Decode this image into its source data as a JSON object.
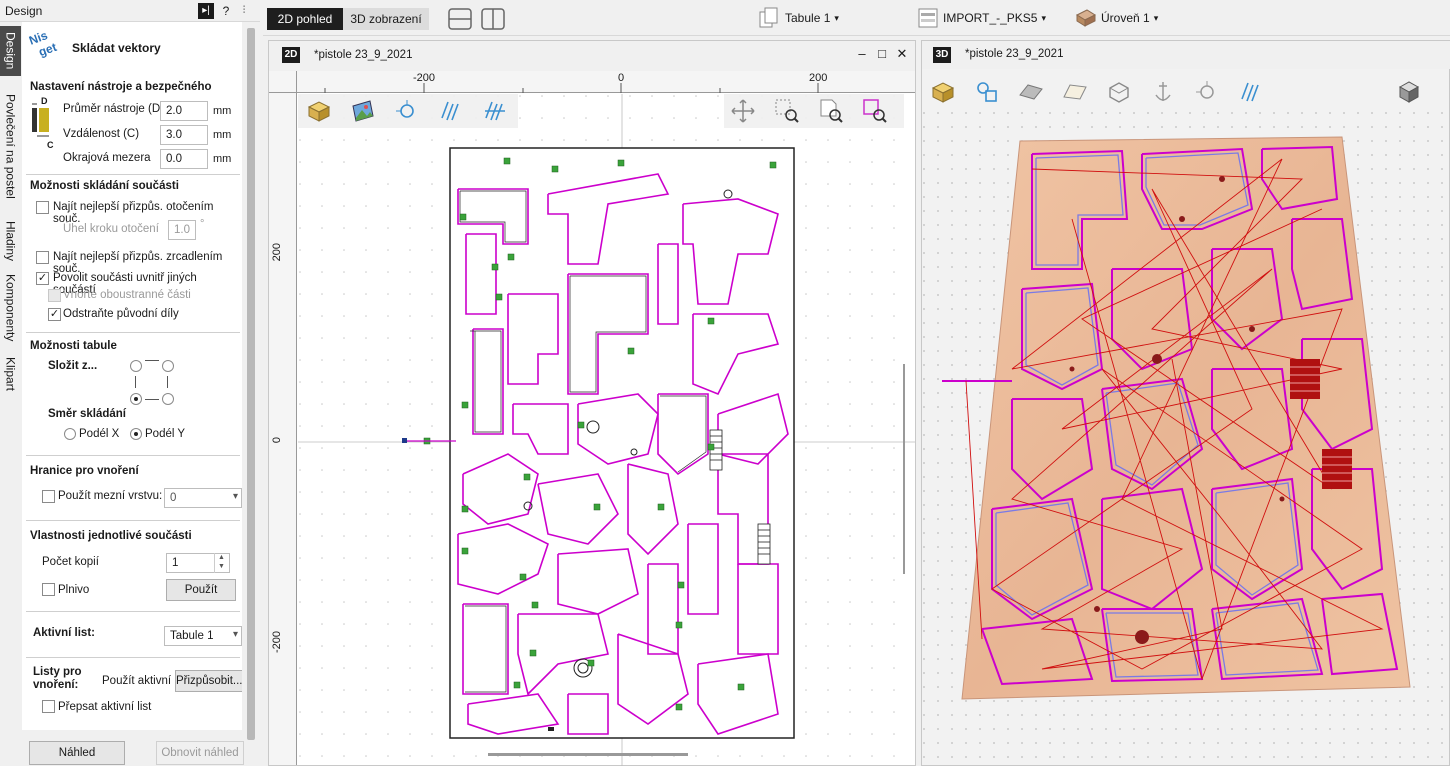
{
  "left_panel": {
    "title": "Design",
    "vertical_tabs": [
      "Design",
      "Povlečení na postel",
      "Hladiny",
      "Komponenty",
      "Klipart"
    ],
    "logo_text": "Nis get",
    "tool_title": "Skládat vektory",
    "tool_settings": {
      "header": "Nastavení nástroje a bezpečného",
      "diameter_label": "Průměr nástroje (D)",
      "diameter_value": "2.0",
      "distance_label": "Vzdálenost (C)",
      "distance_value": "3.0",
      "margin_label": "Okrajová mezera",
      "margin_value": "0.0",
      "unit": "mm",
      "diagram_d": "D",
      "diagram_c": "C"
    },
    "part_options": {
      "header": "Možnosti skládání součásti",
      "rotate_label": "Najít nejlepší přizpůs. otočením souč.",
      "rotate_checked": false,
      "step_label": "Úhel kroku otočení",
      "step_value": "1.0",
      "step_unit": "°",
      "mirror_label": "Najít nejlepší přizpůs. zrcadlením souč.",
      "mirror_checked": false,
      "inside_label": "Povolit součásti uvnitř jiných součástí",
      "inside_checked": true,
      "double_label": "Vnořte oboustranné části",
      "double_checked": false,
      "remove_label": "Odstraňte původní díly",
      "remove_checked": true
    },
    "sheet_options": {
      "header": "Možnosti tabule",
      "fold_label": "Složit z...",
      "direction_label": "Směr skládání",
      "along_x": "Podél X",
      "along_y": "Podél Y",
      "selected_direction": "Podél Y"
    },
    "nesting_boundary": {
      "header": "Hranice pro vnoření",
      "use_limit_label": "Použít mezní vrstvu:",
      "use_limit_checked": false,
      "limit_value": "0"
    },
    "part_properties": {
      "header": "Vlastnosti jednotlivé součásti",
      "copies_label": "Počet kopií",
      "copies_value": "1",
      "filler_label": "Plnivo",
      "filler_checked": false,
      "apply_button": "Použít"
    },
    "active_sheet": {
      "label": "Aktivní list:",
      "value": "Tabule 1"
    },
    "sheets": {
      "label": "Listy pro vnoření:",
      "use_active": "Použít aktivní",
      "customize": "Přizpůsobit...",
      "overwrite_label": "Přepsat aktivní list",
      "overwrite_checked": false
    },
    "buttons": {
      "preview": "Náhled",
      "refresh": "Obnovit náhled"
    }
  },
  "top_toolbar": {
    "tab_2d": "2D pohled",
    "tab_3d": "3D zobrazení",
    "sheet_dropdown": "Tabule 1",
    "layer_dropdown": "IMPORT_-_PKS5",
    "level_dropdown": "Úroveň 1"
  },
  "view2d": {
    "badge": "2D",
    "title": "*pistole 23_9_2021",
    "ruler_x": [
      "-200",
      "0",
      "200"
    ],
    "ruler_y": [
      "200",
      "0",
      "-200"
    ]
  },
  "view3d": {
    "badge": "3D",
    "title": "*pistole 23_9_2021"
  },
  "colors": {
    "accent": "#cc00cc",
    "material": "#e9b89a",
    "active_tab": "#1e1e1e"
  }
}
